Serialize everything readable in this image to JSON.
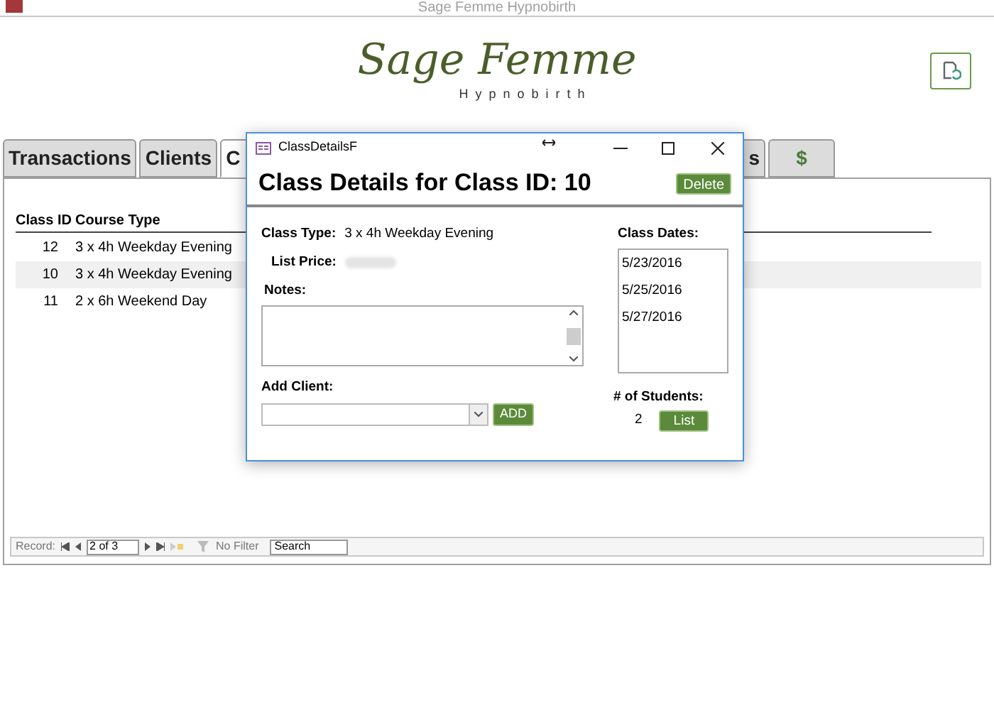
{
  "window": {
    "title": "Sage Femme Hypnobirth"
  },
  "logo": {
    "name": "Sage Femme",
    "tagline": "Hypnobirth"
  },
  "tabs": [
    {
      "label": "Transactions",
      "selected": false
    },
    {
      "label": "Clients",
      "selected": false
    },
    {
      "label": "C",
      "selected": true
    },
    {
      "label": "s",
      "selected": false
    },
    {
      "label": "$",
      "selected": false
    }
  ],
  "table": {
    "columns": [
      "Class ID",
      "Course Type"
    ],
    "rows": [
      {
        "cells": [
          "12",
          "3 x 4h Weekday Evening"
        ],
        "selected": false
      },
      {
        "cells": [
          "10",
          "3 x 4h Weekday Evening"
        ],
        "selected": true
      },
      {
        "cells": [
          "11",
          "2 x 6h Weekend Day"
        ],
        "selected": false
      }
    ]
  },
  "record_nav": {
    "label": "Record:",
    "position": "2 of 3",
    "filter": "No Filter",
    "search": "Search"
  },
  "dialog": {
    "title": "ClassDetailsF",
    "heading": "Class Details for Class ID: 10",
    "delete_button": "Delete",
    "class_type_label": "Class Type:",
    "class_type": "3 x 4h Weekday Evening",
    "list_price_label": "List Price:",
    "notes_label": "Notes:",
    "add_client_label": "Add Client:",
    "add_button": "ADD",
    "class_dates_label": "Class Dates:",
    "class_dates": [
      "5/23/2016",
      "5/25/2016",
      "5/27/2016"
    ],
    "students_label": "# of Students:",
    "students": "2",
    "list_button": "List"
  }
}
